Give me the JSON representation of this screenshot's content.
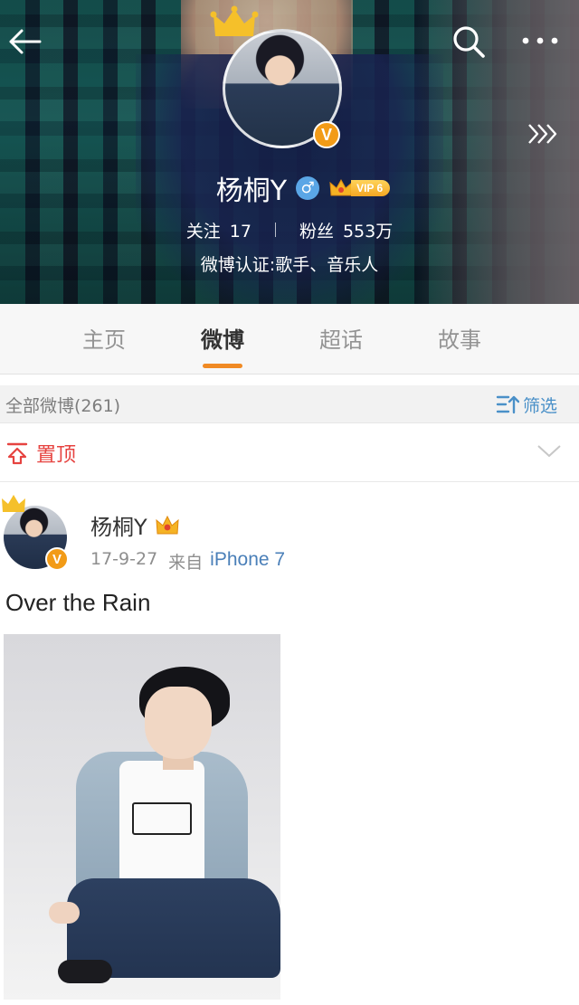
{
  "colors": {
    "accent": "#f08a24",
    "link": "#4a7fb8",
    "pinned": "#e64340",
    "verified_badge": "#f29b17",
    "gender_male": "#5aa6e6"
  },
  "header": {
    "back_icon": "back-arrow-icon",
    "search_icon": "search-icon",
    "more_icon": "more-dots-icon",
    "expand_icon": "double-chevron-right-icon"
  },
  "profile": {
    "name": "杨桐Y",
    "badge": "V",
    "vip_label": "VIP 6",
    "following_label": "关注",
    "following_count": "17",
    "followers_label": "粉丝",
    "followers_count": "553万",
    "verification": "微博认证:歌手、音乐人"
  },
  "tabs": [
    {
      "label": "主页"
    },
    {
      "label": "微博"
    },
    {
      "label": "超话"
    },
    {
      "label": "故事"
    }
  ],
  "active_tab": 1,
  "list": {
    "count_label": "全部微博(261)",
    "filter_label": "筛选"
  },
  "pinned": {
    "label": "置顶"
  },
  "post": {
    "author": "杨桐Y",
    "badge": "V",
    "date": "17-9-27",
    "source_prefix": "来自",
    "source": "iPhone 7",
    "text": "Over the Rain"
  }
}
